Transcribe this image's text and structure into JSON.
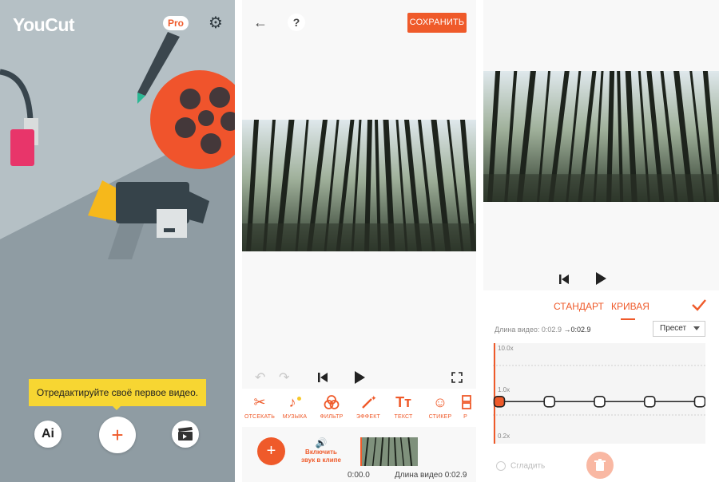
{
  "home": {
    "logo": "YouCut",
    "pro_badge": "Pro",
    "settings_icon": "gear-icon",
    "tooltip": "Отредактируйте своё первое видео.",
    "ai_label": "Ai",
    "add_label": "+",
    "colors": {
      "background": "#9aa7ae",
      "tooltip": "#f7d632",
      "accent": "#ef5a2a"
    }
  },
  "editor": {
    "save_label": "СОХРАНИТЬ",
    "help_label": "?",
    "back_icon": "arrow-left-icon",
    "tools": [
      {
        "label": "ОТСЕКАТЬ",
        "icon": "scissors-icon"
      },
      {
        "label": "МУЗЫКА",
        "icon": "music-icon"
      },
      {
        "label": "ФИЛЬТР",
        "icon": "filter-icon"
      },
      {
        "label": "ЭФФЕКТ",
        "icon": "magic-wand-icon"
      },
      {
        "label": "ТЕКСТ",
        "icon": "text-icon"
      },
      {
        "label": "СТИКЕР",
        "icon": "smiley-icon"
      },
      {
        "label": "Р",
        "icon": "ratio-icon"
      }
    ],
    "add_clip_label": "+",
    "sound_label": "Включить звук в клипе",
    "current_time": "0:00.0",
    "video_length": "Длина видео 0:02.9"
  },
  "speed": {
    "tab_standard": "СТАНДАРТ",
    "tab_curve": "КРИВАЯ",
    "length_label": "Длина видео: 0:02.9",
    "length_arrow": "→",
    "length_new": "0:02.9",
    "preset_label": "Пресет",
    "axis_top": "10.0x",
    "axis_mid": "1.0x",
    "axis_bottom": "0.2x",
    "smooth_label": "Сгладить",
    "curve_points": [
      1.0,
      1.0,
      1.0,
      1.0,
      1.0
    ]
  }
}
